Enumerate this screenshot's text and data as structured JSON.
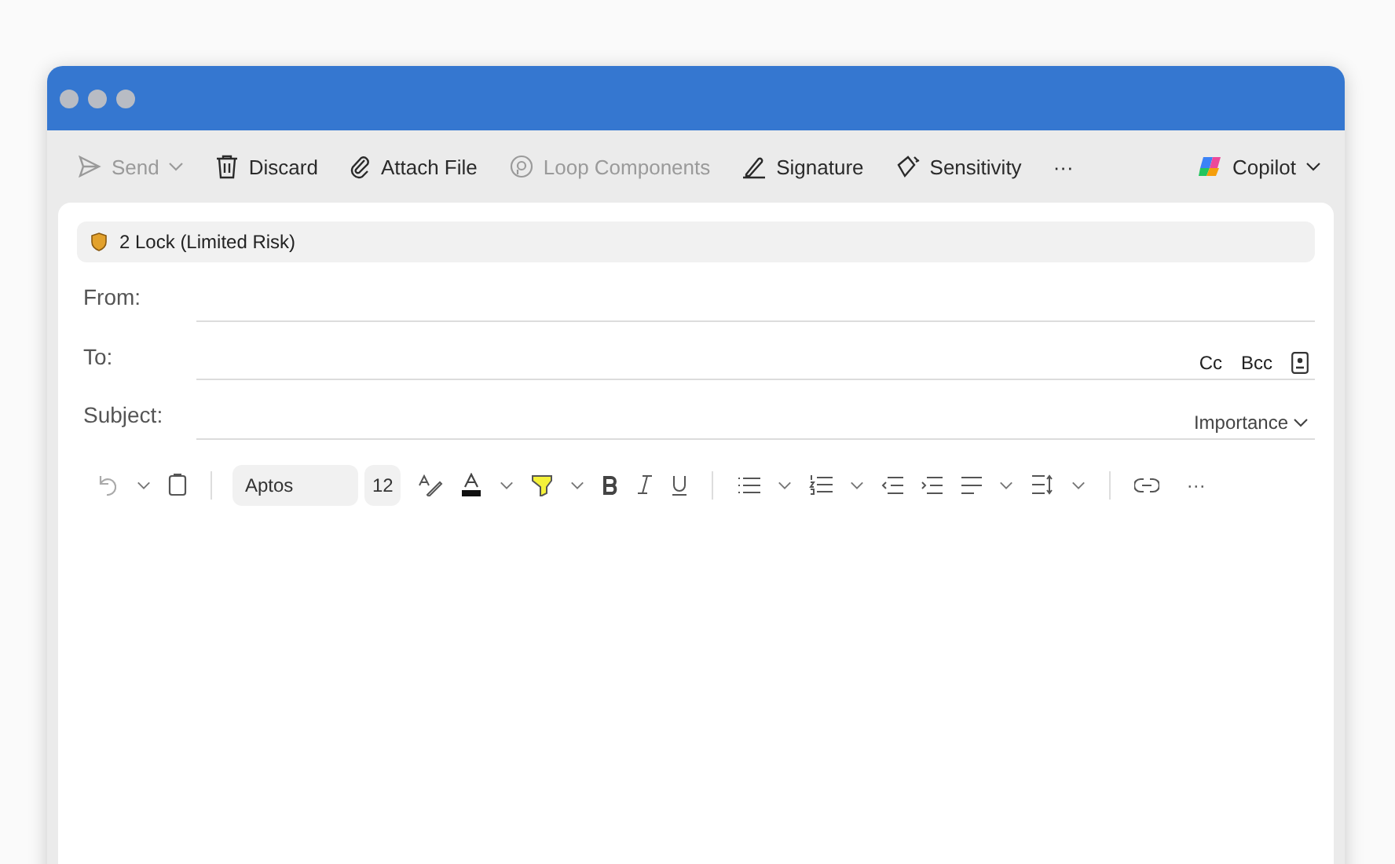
{
  "toolbar": [
    {
      "kind": "send",
      "label": "Send",
      "disabled": true,
      "dropdown": true
    },
    {
      "kind": "discard",
      "label": "Discard",
      "disabled": false,
      "dropdown": false
    },
    {
      "kind": "attach",
      "label": "Attach File",
      "disabled": false,
      "dropdown": false
    },
    {
      "kind": "loop",
      "label": "Loop Components",
      "disabled": true,
      "dropdown": false
    },
    {
      "kind": "signature",
      "label": "Signature",
      "disabled": false,
      "dropdown": false
    },
    {
      "kind": "sensitivity",
      "label": "Sensitivity",
      "disabled": false,
      "dropdown": false
    },
    {
      "kind": "more",
      "label": "···",
      "disabled": false,
      "dropdown": false
    },
    {
      "kind": "copilot",
      "label": "Copilot",
      "disabled": false,
      "dropdown": true
    }
  ],
  "sensitivity_banner": {
    "label": "2 Lock (Limited Risk)"
  },
  "fields": [
    {
      "label": "From:"
    },
    {
      "label": "To:",
      "actions": [
        "Cc",
        "Bcc"
      ],
      "address_book": true
    },
    {
      "label": "Subject:",
      "importance": "Importance"
    }
  ],
  "format_bar": {
    "font": "Aptos",
    "size": "12",
    "more": "···"
  }
}
